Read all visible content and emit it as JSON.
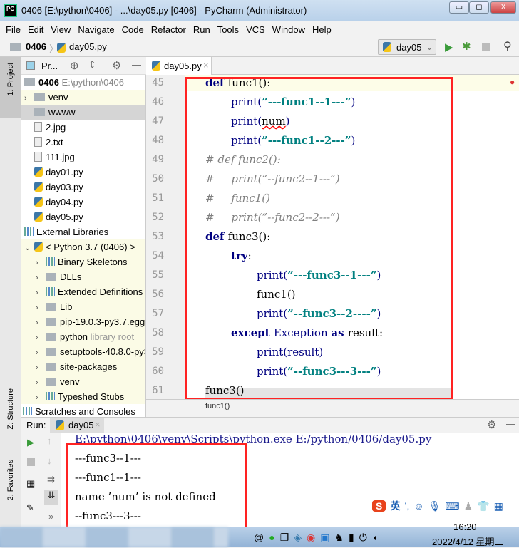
{
  "window": {
    "title": "0406 [E:\\python\\0406] - ...\\day05.py [0406] - PyCharm (Administrator)",
    "logo": "PC",
    "minimize": "▭",
    "restore": "◻",
    "close": "X"
  },
  "menu": [
    "File",
    "Edit",
    "View",
    "Navigate",
    "Code",
    "Refactor",
    "Run",
    "Tools",
    "VCS",
    "Window",
    "Help"
  ],
  "nav": {
    "project": "0406",
    "file": "day05.py",
    "run_config": "day05"
  },
  "project_panel": {
    "title": "Pr...",
    "side_label": "1: Project",
    "root": "0406",
    "root_path": "E:\\python\\0406",
    "items": [
      {
        "label": "venv",
        "type": "folder",
        "chev": true,
        "indent": 0,
        "state": "yel"
      },
      {
        "label": "wwww",
        "type": "folder",
        "chev": false,
        "indent": 0,
        "state": "sel"
      },
      {
        "label": "2.jpg",
        "type": "file",
        "indent": 0
      },
      {
        "label": "2.txt",
        "type": "file",
        "indent": 0
      },
      {
        "label": "111.jpg",
        "type": "file",
        "indent": 0
      },
      {
        "label": "day01.py",
        "type": "py",
        "indent": 0
      },
      {
        "label": "day03.py",
        "type": "py",
        "indent": 0
      },
      {
        "label": "day04.py",
        "type": "py",
        "indent": 0
      },
      {
        "label": "day05.py",
        "type": "py",
        "indent": 0
      }
    ],
    "external_libraries": "External Libraries",
    "sdk": "< Python 3.7 (0406) >",
    "sdk_items": [
      {
        "label": "Binary Skeletons",
        "type": "lib"
      },
      {
        "label": "DLLs",
        "type": "folder"
      },
      {
        "label": "Extended Definitions",
        "type": "lib"
      },
      {
        "label": "Lib",
        "type": "folder"
      },
      {
        "label": "pip-19.0.3-py3.7.egg",
        "type": "folder"
      },
      {
        "label": "python",
        "hint": "library root",
        "type": "folder"
      },
      {
        "label": "setuptools-40.8.0-py3.7.egg",
        "type": "folder"
      },
      {
        "label": "site-packages",
        "type": "folder"
      },
      {
        "label": "venv",
        "type": "folder"
      },
      {
        "label": "Typeshed Stubs",
        "type": "lib"
      }
    ],
    "scratches": "Scratches and Consoles"
  },
  "side_labels": {
    "structure": "Z: Structure",
    "favorites": "2: Favorites"
  },
  "editor": {
    "tab": "day05.py",
    "breadcrumb": "func1()",
    "lines": [
      {
        "n": "45",
        "indent": 0,
        "tokens": [
          [
            "kw",
            "def "
          ],
          [
            "pl",
            "func1():"
          ]
        ]
      },
      {
        "n": "46",
        "indent": 1,
        "tokens": [
          [
            "fn",
            "print("
          ],
          [
            "str",
            "”---func1--1---”"
          ],
          [
            "fn",
            ")"
          ]
        ]
      },
      {
        "n": "47",
        "indent": 1,
        "tokens": [
          [
            "fn",
            "print("
          ],
          [
            "err",
            "num"
          ],
          [
            "fn",
            ")"
          ]
        ]
      },
      {
        "n": "48",
        "indent": 1,
        "tokens": [
          [
            "fn",
            "print("
          ],
          [
            "str",
            "”---func1--2---”"
          ],
          [
            "fn",
            ")"
          ]
        ]
      },
      {
        "n": "49",
        "indent": 0,
        "tokens": [
          [
            "cm",
            "# def func2():"
          ]
        ]
      },
      {
        "n": "50",
        "indent": 0,
        "tokens": [
          [
            "cm",
            "#     print(”--func2--1---”)"
          ]
        ]
      },
      {
        "n": "51",
        "indent": 0,
        "tokens": [
          [
            "cm",
            "#     func1()"
          ]
        ]
      },
      {
        "n": "52",
        "indent": 0,
        "tokens": [
          [
            "cm",
            "#     print(”--func2--2---”)"
          ]
        ]
      },
      {
        "n": "53",
        "indent": 0,
        "tokens": [
          [
            "kw",
            "def "
          ],
          [
            "pl",
            "func3():"
          ]
        ]
      },
      {
        "n": "54",
        "indent": 1,
        "tokens": [
          [
            "kw",
            "try"
          ],
          [
            "pl",
            ":"
          ]
        ]
      },
      {
        "n": "55",
        "indent": 2,
        "tokens": [
          [
            "fn",
            "print("
          ],
          [
            "str",
            "”---func3--1---”"
          ],
          [
            "fn",
            ")"
          ]
        ]
      },
      {
        "n": "56",
        "indent": 2,
        "tokens": [
          [
            "pl",
            "func1()"
          ]
        ]
      },
      {
        "n": "57",
        "indent": 2,
        "tokens": [
          [
            "fn",
            "print("
          ],
          [
            "str",
            "”--func3--2----”"
          ],
          [
            "fn",
            ")"
          ]
        ]
      },
      {
        "n": "58",
        "indent": 1,
        "tokens": [
          [
            "kw",
            "except "
          ],
          [
            "fn",
            "Exception "
          ],
          [
            "kw",
            "as "
          ],
          [
            "pl",
            "result:"
          ]
        ]
      },
      {
        "n": "59",
        "indent": 2,
        "tokens": [
          [
            "fn",
            "print(result)"
          ]
        ]
      },
      {
        "n": "60",
        "indent": 2,
        "tokens": [
          [
            "fn",
            "print("
          ],
          [
            "str",
            "”--func3---3---”"
          ],
          [
            "fn",
            ")"
          ]
        ]
      },
      {
        "n": "61",
        "indent": 0,
        "tokens": [
          [
            "pl",
            "func3()"
          ]
        ]
      }
    ]
  },
  "run": {
    "label": "Run:",
    "tab": "day05",
    "output": [
      "E:\\python\\0406\\venv\\Scripts\\python.exe E:/python/0406/day05.py",
      "---func3--1---",
      "---func1--1---",
      "name ’num’ is not defined",
      "--func3---3---"
    ]
  },
  "ime": {
    "label": "英"
  },
  "taskbar": {
    "time": "16:20",
    "date": "2022/4/12 星期二"
  },
  "colors": {
    "highlight_box": "#ff2222",
    "keyword": "#000080",
    "string": "#008080",
    "comment": "#808080"
  }
}
